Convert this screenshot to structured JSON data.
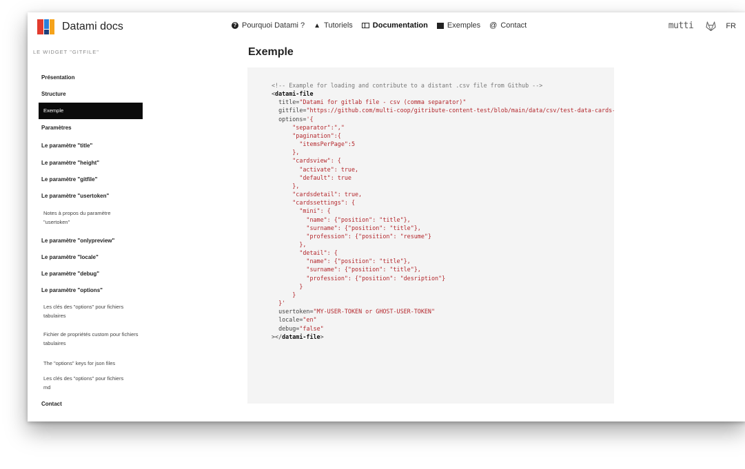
{
  "brand": {
    "title": "Datami docs"
  },
  "nav": {
    "items": [
      {
        "icon": "question-circle-icon",
        "label": "Pourquoi Datami ?"
      },
      {
        "icon": "graduation-cap-icon",
        "label": "Tutoriels"
      },
      {
        "icon": "book-icon",
        "label": "Documentation"
      },
      {
        "icon": "film-icon",
        "label": "Exemples"
      },
      {
        "icon": "at-icon",
        "label": "Contact"
      }
    ],
    "active": "Documentation",
    "multi_logo": "mutti",
    "lang": "FR"
  },
  "sidebar": {
    "heading": "LE WIDGET \"GITFILE\"",
    "items": [
      {
        "label": "Présentation",
        "kind": "section"
      },
      {
        "label": "Structure",
        "kind": "section"
      },
      {
        "label": "Exemple",
        "kind": "active"
      },
      {
        "label": "Paramètres",
        "kind": "section"
      },
      {
        "label": "Le paramètre \"title\"",
        "kind": "section"
      },
      {
        "label": "Le paramètre \"height\"",
        "kind": "section"
      },
      {
        "label": "Le paramètre \"gitfile\"",
        "kind": "section"
      },
      {
        "label": "Le paramètre \"usertoken\"",
        "kind": "section"
      },
      {
        "label": "Notes à propos du paramètre \"usertoken\"",
        "kind": "sub"
      },
      {
        "label": "Le paramètre \"onlypreview\"",
        "kind": "section"
      },
      {
        "label": "Le paramètre \"locale\"",
        "kind": "section"
      },
      {
        "label": "Le paramètre \"debug\"",
        "kind": "section"
      },
      {
        "label": "Le paramètre \"options\"",
        "kind": "section"
      },
      {
        "label": "Les clés des \"options\" pour fichiers tabulaires",
        "kind": "sub"
      },
      {
        "label": "Fichier de propriétés custom pour fichiers tabulaires",
        "kind": "sub"
      },
      {
        "label": "The \"options\" keys for json files",
        "kind": "sub"
      },
      {
        "label": "Les clés des \"options\" pour fichiers md",
        "kind": "sub"
      },
      {
        "label": "Contact",
        "kind": "section"
      }
    ]
  },
  "main": {
    "title": "Exemple",
    "code": {
      "comment": "<!-- Example for loading and contribute to a distant .csv file from Github -->",
      "tag_open": "<",
      "tag_name": "datami-file",
      "title_attr": "title=",
      "title_val": "\"Datami for gitlab file - csv (comma separator)\"",
      "gitfile_attr": "gitfile=",
      "gitfile_val": "\"https://github.com/multi-coop/gitribute-content-test/blob/main/data/csv/test-data-cards-comma.csv\"",
      "options_attr": "options=",
      "options_lines": [
        "'{",
        "  \"separator\":\",\"",
        "  \"pagination\":{",
        "    \"itemsPerPage\":5",
        "  },",
        "  \"cardsview\": {",
        "    \"activate\": true,",
        "    \"default\": true",
        "  },",
        "  \"cardsdetail\": true,",
        "  \"cardssettings\": {",
        "    \"mini\": {",
        "      \"name\": {\"position\": \"title\"},",
        "      \"surname\": {\"position\": \"title\"},",
        "      \"profession\": {\"position\": \"resume\"}",
        "    },",
        "    \"detail\": {",
        "      \"name\": {\"position\": \"title\"},",
        "      \"surname\": {\"position\": \"title\"},",
        "      \"profession\": {\"position\": \"desription\"}",
        "    }",
        "  }",
        "}'"
      ],
      "usertoken_attr": "usertoken=",
      "usertoken_val": "\"MY-USER-TOKEN or GHOST-USER-TOKEN\"",
      "locale_attr": "locale=",
      "locale_val": "\"en\"",
      "debug_attr": "debug=",
      "debug_val": "\"false\"",
      "tag_close_open": "></",
      "tag_close_gt": ">"
    }
  }
}
